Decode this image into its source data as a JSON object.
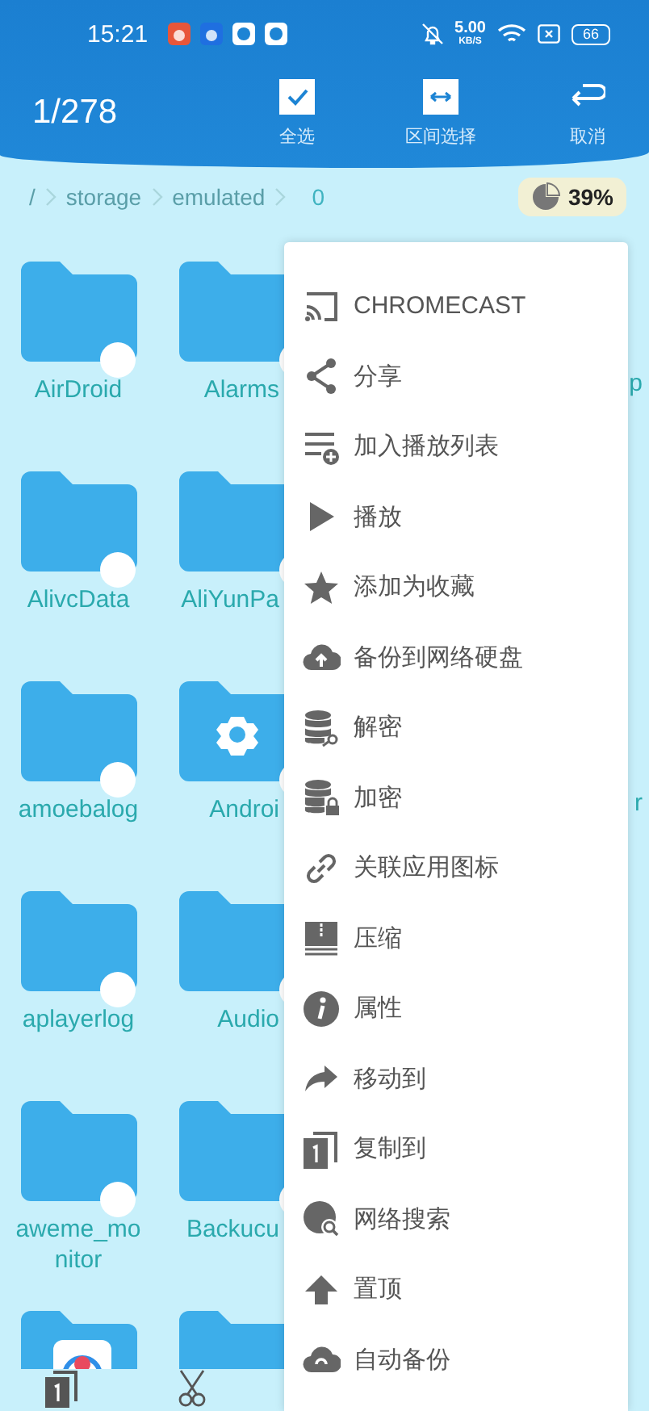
{
  "status_bar": {
    "time": "15:21",
    "speed_value": "5.00",
    "speed_unit": "KB/S",
    "battery": "66"
  },
  "toolbar": {
    "count": "1/278",
    "actions": [
      {
        "label": "全选",
        "kind": "select_all"
      },
      {
        "label": "区间选择",
        "kind": "range"
      },
      {
        "label": "取消",
        "kind": "cancel"
      }
    ]
  },
  "breadcrumb": {
    "segments": [
      "/",
      "storage",
      "emulated",
      "0"
    ],
    "storage_usage": "39%"
  },
  "grid": {
    "rows": [
      {
        "cells": [
          {
            "name": "AirDroid",
            "kind": "folder",
            "selected": false
          },
          {
            "name": "Alarms",
            "kind": "folder",
            "selected": false
          },
          {
            "name": "p"
          }
        ]
      },
      {
        "cells": [
          {
            "name": "AlivcData",
            "kind": "folder",
            "selected": false
          },
          {
            "name": "AliYunPa",
            "kind": "folder",
            "selected": false
          }
        ]
      },
      {
        "cells": [
          {
            "name": "amoebalog",
            "kind": "folder",
            "selected": false
          },
          {
            "name": "Androi",
            "kind": "settings",
            "selected": false
          },
          {
            "name": "r"
          }
        ]
      },
      {
        "cells": [
          {
            "name": "aplayerlog",
            "kind": "folder",
            "selected": false
          },
          {
            "name": "Audio",
            "kind": "folder",
            "selected": false
          }
        ]
      },
      {
        "cells": [
          {
            "name": "aweme_monitor",
            "kind": "folder",
            "selected": false
          },
          {
            "name": "Backucu",
            "kind": "folder",
            "selected": false
          }
        ]
      },
      {
        "cells": [
          {
            "kind": "app"
          },
          {
            "kind": "folder"
          }
        ]
      }
    ]
  },
  "menu": [
    {
      "label": "CHROMECAST",
      "kind": "cast"
    },
    {
      "label": "分享",
      "kind": "share"
    },
    {
      "label": "加入播放列表",
      "kind": "playlist"
    },
    {
      "label": "播放",
      "kind": "play"
    },
    {
      "label": "添加为收藏",
      "kind": "star"
    },
    {
      "label": "备份到网络硬盘",
      "kind": "upload"
    },
    {
      "label": "解密",
      "kind": "decrypt"
    },
    {
      "label": "加密",
      "kind": "encrypt"
    },
    {
      "label": "关联应用图标",
      "kind": "link"
    },
    {
      "label": "压缩",
      "kind": "zip"
    },
    {
      "label": "属性",
      "kind": "info"
    },
    {
      "label": "移动到",
      "kind": "move"
    },
    {
      "label": "复制到",
      "kind": "copy"
    },
    {
      "label": "网络搜索",
      "kind": "websearch"
    },
    {
      "label": "置顶",
      "kind": "top"
    },
    {
      "label": "自动备份",
      "kind": "autobackup"
    }
  ]
}
